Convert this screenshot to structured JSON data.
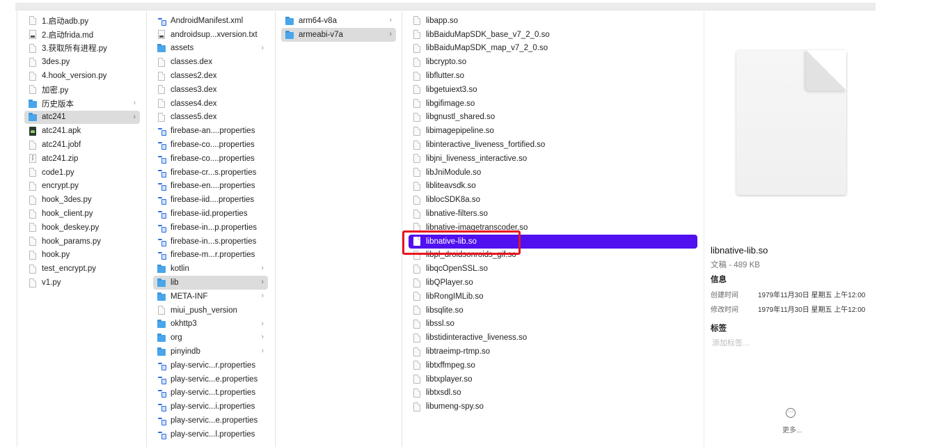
{
  "column1": [
    {
      "label": "1.启动adb.py",
      "icon": "doc"
    },
    {
      "label": "2.启动frida.md",
      "icon": "md"
    },
    {
      "label": "3.获取所有进程.py",
      "icon": "doc"
    },
    {
      "label": "3des.py",
      "icon": "doc"
    },
    {
      "label": "4.hook_version.py",
      "icon": "doc"
    },
    {
      "label": "加密.py",
      "icon": "doc"
    },
    {
      "label": "历史版本",
      "icon": "folder",
      "chevron": true
    },
    {
      "label": "atc241",
      "icon": "folder",
      "chevron": true,
      "selected": "gray"
    },
    {
      "label": "atc241.apk",
      "icon": "apk"
    },
    {
      "label": "atc241.jobf",
      "icon": "doc"
    },
    {
      "label": "atc241.zip",
      "icon": "zip"
    },
    {
      "label": "code1.py",
      "icon": "doc"
    },
    {
      "label": "encrypt.py",
      "icon": "doc"
    },
    {
      "label": "hook_3des.py",
      "icon": "doc"
    },
    {
      "label": "hook_client.py",
      "icon": "doc"
    },
    {
      "label": "hook_deskey.py",
      "icon": "doc"
    },
    {
      "label": "hook_params.py",
      "icon": "doc"
    },
    {
      "label": "hook.py",
      "icon": "doc"
    },
    {
      "label": "test_encrypt.py",
      "icon": "doc"
    },
    {
      "label": "v1.py",
      "icon": "doc"
    }
  ],
  "column2": [
    {
      "label": "AndroidManifest.xml",
      "icon": "prop"
    },
    {
      "label": "androidsup...xversion.txt",
      "icon": "md"
    },
    {
      "label": "assets",
      "icon": "folder",
      "chevron": true
    },
    {
      "label": "classes.dex",
      "icon": "doc"
    },
    {
      "label": "classes2.dex",
      "icon": "doc"
    },
    {
      "label": "classes3.dex",
      "icon": "doc"
    },
    {
      "label": "classes4.dex",
      "icon": "doc"
    },
    {
      "label": "classes5.dex",
      "icon": "doc"
    },
    {
      "label": "firebase-an....properties",
      "icon": "prop"
    },
    {
      "label": "firebase-co....properties",
      "icon": "prop"
    },
    {
      "label": "firebase-co....properties",
      "icon": "prop"
    },
    {
      "label": "firebase-cr...s.properties",
      "icon": "prop"
    },
    {
      "label": "firebase-en....properties",
      "icon": "prop"
    },
    {
      "label": "firebase-iid....properties",
      "icon": "prop"
    },
    {
      "label": "firebase-iid.properties",
      "icon": "prop"
    },
    {
      "label": "firebase-in...p.properties",
      "icon": "prop"
    },
    {
      "label": "firebase-in...s.properties",
      "icon": "prop"
    },
    {
      "label": "firebase-m...r.properties",
      "icon": "prop"
    },
    {
      "label": "kotlin",
      "icon": "folder",
      "chevron": true
    },
    {
      "label": "lib",
      "icon": "folder",
      "chevron": true,
      "selected": "gray"
    },
    {
      "label": "META-INF",
      "icon": "folder",
      "chevron": true
    },
    {
      "label": "miui_push_version",
      "icon": "doc"
    },
    {
      "label": "okhttp3",
      "icon": "folder",
      "chevron": true
    },
    {
      "label": "org",
      "icon": "folder",
      "chevron": true
    },
    {
      "label": "pinyindb",
      "icon": "folder",
      "chevron": true
    },
    {
      "label": "play-servic...r.properties",
      "icon": "prop"
    },
    {
      "label": "play-servic...e.properties",
      "icon": "prop"
    },
    {
      "label": "play-servic...t.properties",
      "icon": "prop"
    },
    {
      "label": "play-servic...i.properties",
      "icon": "prop"
    },
    {
      "label": "play-servic...e.properties",
      "icon": "prop"
    },
    {
      "label": "play-servic...l.properties",
      "icon": "prop"
    }
  ],
  "column3": [
    {
      "label": "arm64-v8a",
      "icon": "folder",
      "chevron": true
    },
    {
      "label": "armeabi-v7a",
      "icon": "folder",
      "chevron": true,
      "selected": "gray"
    }
  ],
  "column4": [
    {
      "label": "libapp.so",
      "icon": "doc"
    },
    {
      "label": "libBaiduMapSDK_base_v7_2_0.so",
      "icon": "doc"
    },
    {
      "label": "libBaiduMapSDK_map_v7_2_0.so",
      "icon": "doc"
    },
    {
      "label": "libcrypto.so",
      "icon": "doc"
    },
    {
      "label": "libflutter.so",
      "icon": "doc"
    },
    {
      "label": "libgetuiext3.so",
      "icon": "doc"
    },
    {
      "label": "libgifimage.so",
      "icon": "doc"
    },
    {
      "label": "libgnustl_shared.so",
      "icon": "doc"
    },
    {
      "label": "libimagepipeline.so",
      "icon": "doc"
    },
    {
      "label": "libinteractive_liveness_fortified.so",
      "icon": "doc"
    },
    {
      "label": "libjni_liveness_interactive.so",
      "icon": "doc"
    },
    {
      "label": "libJniModule.so",
      "icon": "doc"
    },
    {
      "label": "libliteavsdk.so",
      "icon": "doc"
    },
    {
      "label": "liblocSDK8a.so",
      "icon": "doc"
    },
    {
      "label": "libnative-filters.so",
      "icon": "doc"
    },
    {
      "label": "libnative-imagetranscoder.so",
      "icon": "doc"
    },
    {
      "label": "libnative-lib.so",
      "icon": "doc",
      "selected": "blue"
    },
    {
      "label": "libpl_droidsonroids_gif.so",
      "icon": "doc"
    },
    {
      "label": "libqcOpenSSL.so",
      "icon": "doc"
    },
    {
      "label": "libQPlayer.so",
      "icon": "doc"
    },
    {
      "label": "libRongIMLib.so",
      "icon": "doc"
    },
    {
      "label": "libsqlite.so",
      "icon": "doc"
    },
    {
      "label": "libssl.so",
      "icon": "doc"
    },
    {
      "label": "libstidinteractive_liveness.so",
      "icon": "doc"
    },
    {
      "label": "libtraeimp-rtmp.so",
      "icon": "doc"
    },
    {
      "label": "libtxffmpeg.so",
      "icon": "doc"
    },
    {
      "label": "libtxplayer.so",
      "icon": "doc"
    },
    {
      "label": "libtxsdl.so",
      "icon": "doc"
    },
    {
      "label": "libumeng-spy.so",
      "icon": "doc"
    }
  ],
  "preview": {
    "file_name": "libnative-lib.so",
    "kind_size": "文稿 - 489 KB",
    "info_heading": "信息",
    "created_label": "创建时间",
    "created_value": "1979年11月30日 星期五 上午12:00",
    "modified_label": "修改时间",
    "modified_value": "1979年11月30日 星期五 上午12:00",
    "tags_heading": "标签",
    "add_tags_placeholder": "添加标签…",
    "more_icon": "ellipsis-circle-icon",
    "more_label": "更多..."
  },
  "colors": {
    "selection_blue": "#5010f0",
    "selection_gray": "#dcdcdc",
    "highlight_red": "#e8141e",
    "folder_blue": "#4aa5ea"
  }
}
